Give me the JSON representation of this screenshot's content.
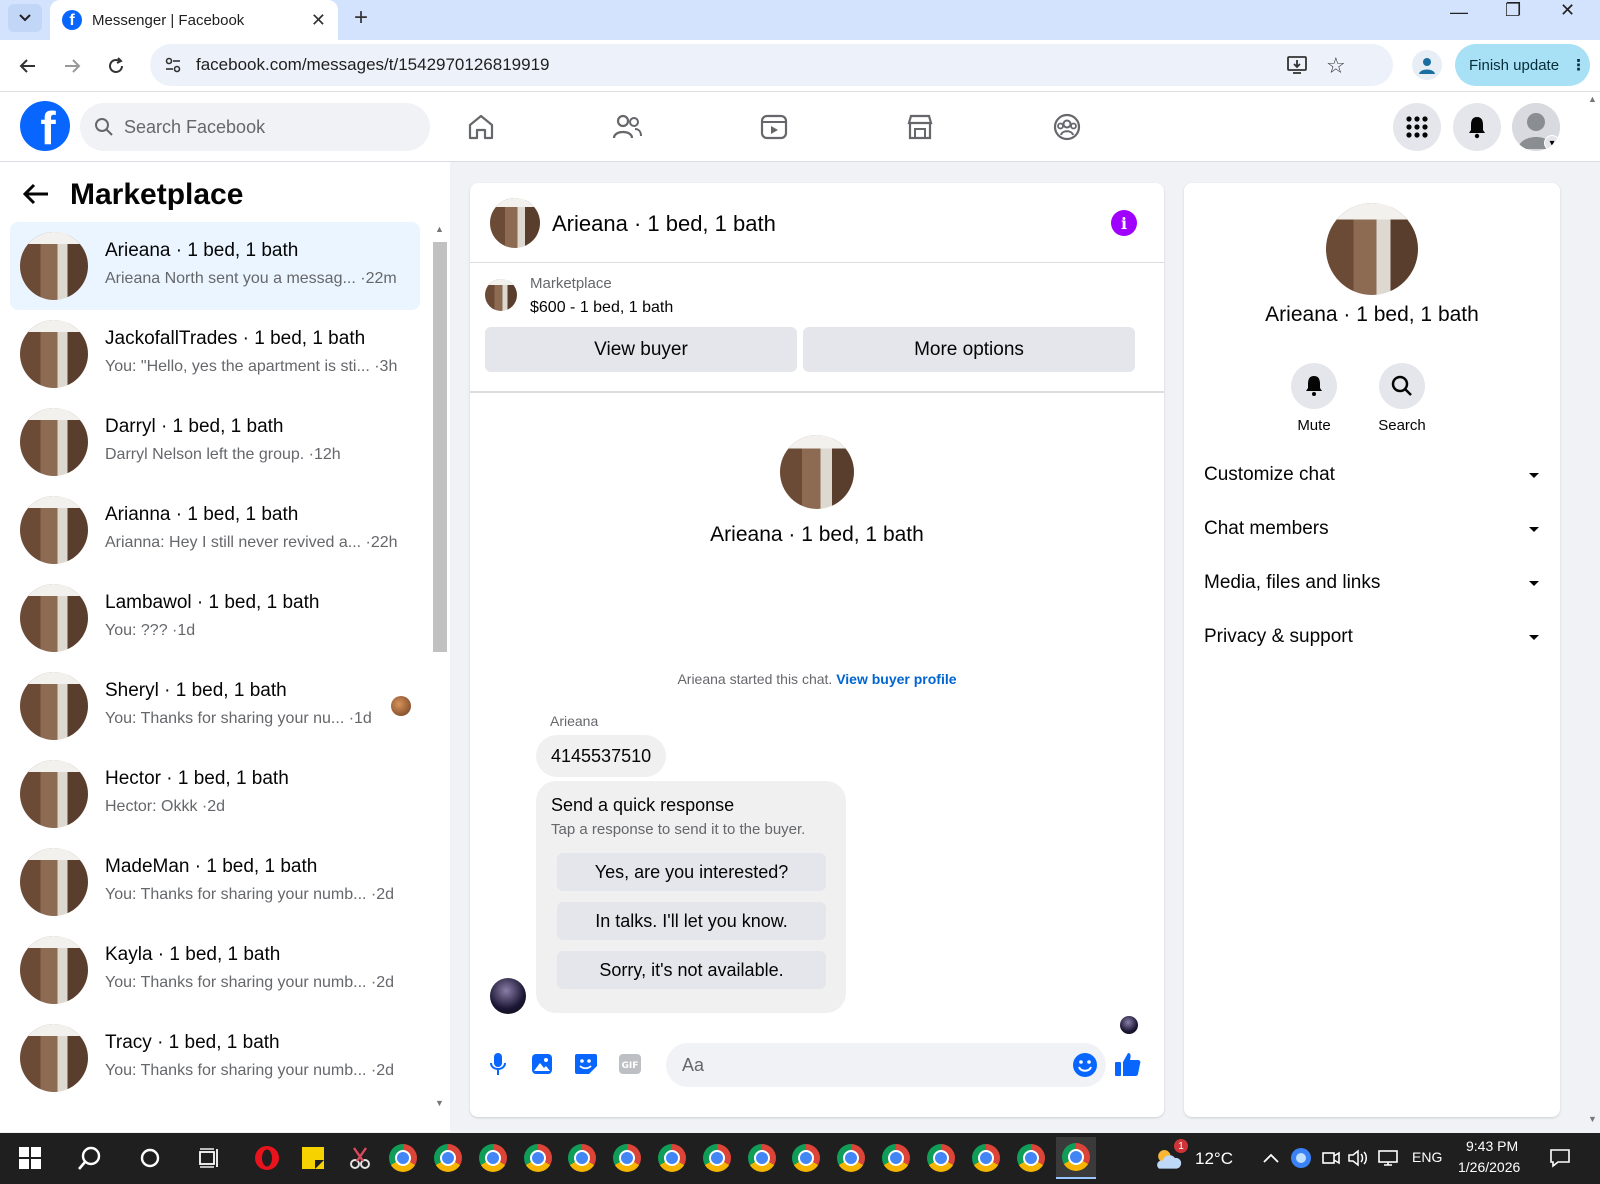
{
  "browser": {
    "tab_title": "Messenger | Facebook",
    "url": "facebook.com/messages/t/1542970126819919",
    "update_label": "Finish update"
  },
  "fb": {
    "search_placeholder": "Search Facebook"
  },
  "left": {
    "title": "Marketplace",
    "conversations": [
      {
        "name": "Arieana · 1 bed, 1 bath",
        "preview": "Arieana North sent you a messag... ·22m"
      },
      {
        "name": "JackofallTrades · 1 bed, 1 bath",
        "preview": "You: \"Hello, yes the apartment is sti... ·3h"
      },
      {
        "name": "Darryl · 1 bed, 1 bath",
        "preview": "Darryl Nelson left the group. ·12h"
      },
      {
        "name": "Arianna · 1 bed, 1 bath",
        "preview": "Arianna: Hey I still never revived a... ·22h"
      },
      {
        "name": "Lambawol · 1 bed, 1 bath",
        "preview": "You: ??? ·1d"
      },
      {
        "name": "Sheryl · 1 bed, 1 bath",
        "preview": "You: Thanks for sharing your nu... ·1d"
      },
      {
        "name": "Hector · 1 bed, 1 bath",
        "preview": "Hector: Okkk ·2d"
      },
      {
        "name": "MadeMan · 1 bed, 1 bath",
        "preview": "You: Thanks for sharing your numb... ·2d"
      },
      {
        "name": "Kayla · 1 bed, 1 bath",
        "preview": "You: Thanks for sharing your numb... ·2d"
      },
      {
        "name": "Tracy · 1 bed, 1 bath",
        "preview": "You: Thanks for sharing your numb... ·2d"
      }
    ]
  },
  "chat": {
    "title": "Arieana · 1 bed, 1 bath",
    "marketplace_label": "Marketplace",
    "listing": "$600 - 1 bed, 1 bath",
    "view_buyer": "View buyer",
    "more_options": "More options",
    "center_name": "Arieana · 1 bed, 1 bath",
    "started_text": "Arieana started this chat.",
    "view_buyer_profile": "View buyer profile",
    "sender": "Arieana",
    "message": "4145537510",
    "quick_title": "Send a quick response",
    "quick_sub": "Tap a response to send it to the buyer.",
    "quick_responses": [
      "Yes, are you interested?",
      "In talks. I'll let you know.",
      "Sorry, it's not available."
    ],
    "composer_placeholder": "Aa"
  },
  "right": {
    "name": "Arieana · 1 bed, 1 bath",
    "mute": "Mute",
    "search": "Search",
    "sections": [
      "Customize chat",
      "Chat members",
      "Media, files and links",
      "Privacy & support"
    ]
  },
  "taskbar": {
    "temp": "12°C",
    "lang": "ENG",
    "time": "9:43 PM",
    "date": "1/26/2026",
    "weather_badge": "1"
  },
  "colors": {
    "fb_blue": "#0866ff",
    "info_purple": "#a000ff",
    "link_blue": "#0064d1",
    "active_row": "#ebf5ff"
  }
}
